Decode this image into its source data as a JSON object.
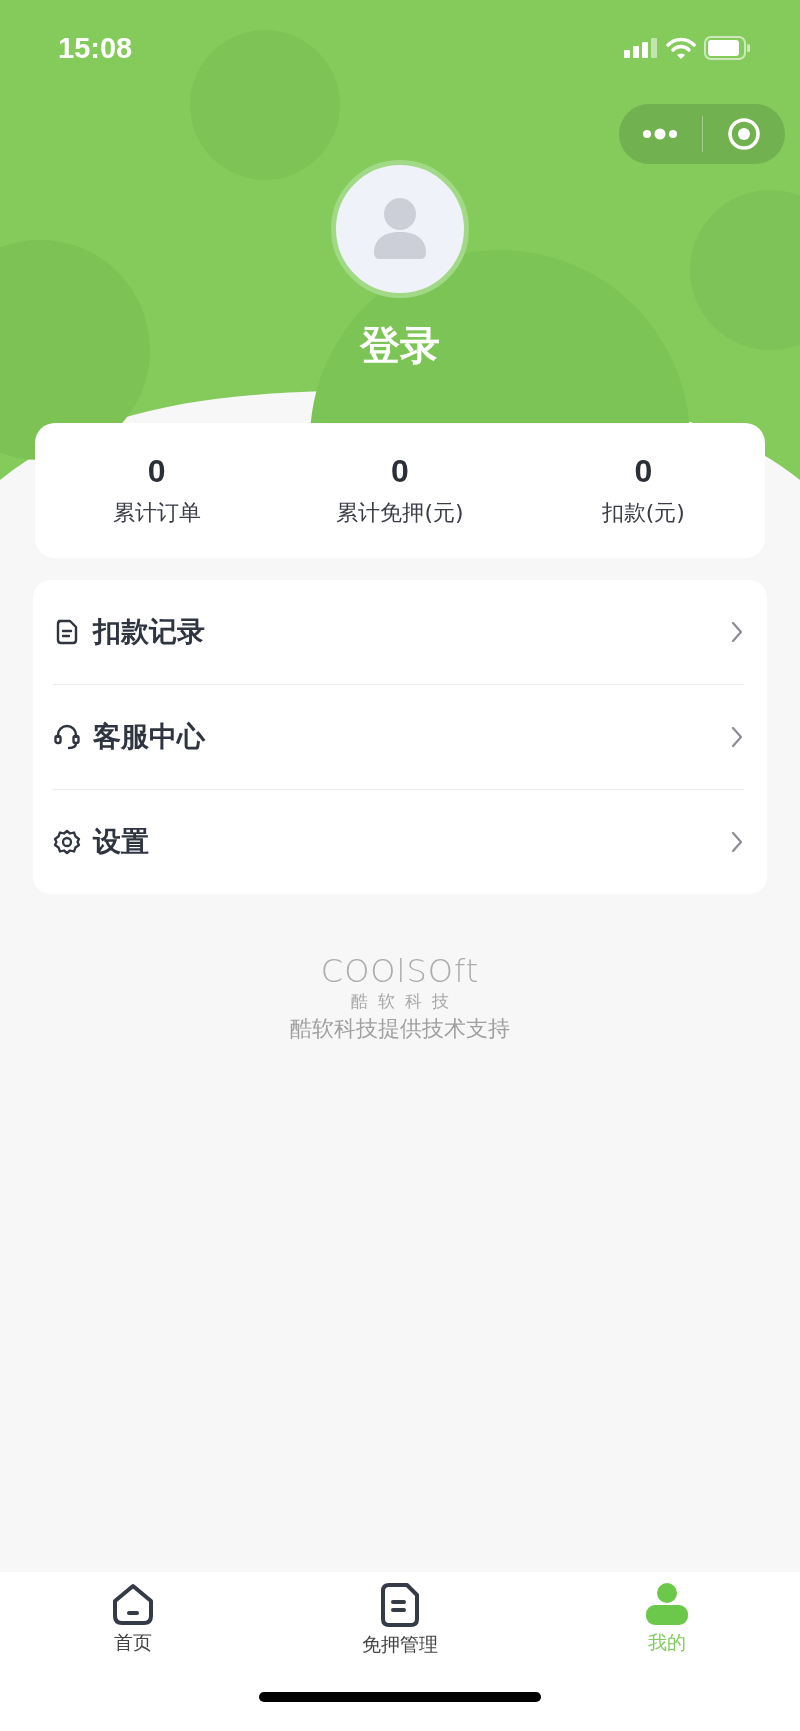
{
  "status_bar": {
    "time": "15:08"
  },
  "profile": {
    "login_label": "登录"
  },
  "stats": [
    {
      "value": "0",
      "label": "累计订单"
    },
    {
      "value": "0",
      "label": "累计免押(元)"
    },
    {
      "value": "0",
      "label": "扣款(元)"
    }
  ],
  "menu": [
    {
      "kind": "records",
      "label": "扣款记录"
    },
    {
      "kind": "service",
      "label": "客服中心"
    },
    {
      "kind": "settings",
      "label": "设置"
    }
  ],
  "footer": {
    "logo_text": "COOlSOft",
    "logo_subtitle": "酷软科技",
    "support_text": "酷软科技提供技术支持"
  },
  "tabs": [
    {
      "kind": "home",
      "label": "首页",
      "selected": false
    },
    {
      "kind": "deposit",
      "label": "免押管理",
      "selected": false
    },
    {
      "kind": "mine",
      "label": "我的",
      "selected": true
    }
  ]
}
